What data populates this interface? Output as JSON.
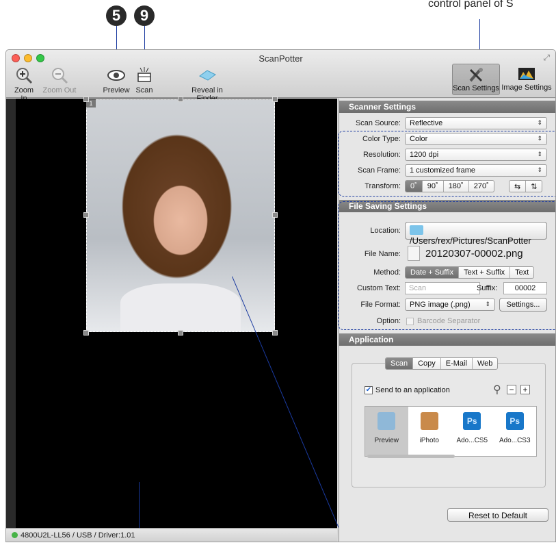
{
  "annotations": {
    "callout_5": "5",
    "callout_9": "9",
    "note_top_right": "control panel of S"
  },
  "window": {
    "title": "ScanPotter"
  },
  "toolbar": {
    "zoom_in": "Zoom In",
    "zoom_out": "Zoom Out",
    "preview": "Preview",
    "scan": "Scan",
    "reveal": "Reveal in Finder",
    "scan_settings": "Scan Settings",
    "image_settings": "Image Settings"
  },
  "preview_area": {
    "frame_number": "1"
  },
  "status": {
    "device": "4800U2L-LL56 / USB / Driver:1.01"
  },
  "scanner_settings": {
    "header": "Scanner Settings",
    "scan_source_label": "Scan Source:",
    "scan_source": "Reflective",
    "color_type_label": "Color Type:",
    "color_type": "Color",
    "resolution_label": "Resolution:",
    "resolution": "1200 dpi",
    "scan_frame_label": "Scan Frame:",
    "scan_frame": "1 customized frame",
    "transform_label": "Transform:",
    "transform_options": [
      "0˚",
      "90˚",
      "180˚",
      "270˚"
    ],
    "selected_rotation": "0˚"
  },
  "file_saving": {
    "header": "File Saving Settings",
    "location_label": "Location:",
    "location": "/Users/rex/Pictures/ScanPotter",
    "file_name_label": "File Name:",
    "file_name": "20120307-00002.png",
    "method_label": "Method:",
    "method_options": [
      "Date + Suffix",
      "Text + Suffix",
      "Text"
    ],
    "selected_method": "Date + Suffix",
    "custom_text_label": "Custom Text:",
    "custom_text_placeholder": "Scan",
    "suffix_label": "Suffix:",
    "suffix": "00002",
    "file_format_label": "File Format:",
    "file_format": "PNG image (.png)",
    "settings_button": "Settings...",
    "option_label": "Option:",
    "barcode_separator": "Barcode Separator"
  },
  "application": {
    "header": "Application",
    "tabs": [
      "Scan",
      "Copy",
      "E-Mail",
      "Web"
    ],
    "selected_tab": "Scan",
    "send_to_app_label": "Send to an application",
    "apps": [
      "Preview",
      "iPhoto",
      "Ado...CS5",
      "Ado...CS3"
    ],
    "selected_app": "Preview",
    "reset_button": "Reset to Default"
  },
  "colors": {
    "accent_line": "#1a3aa0",
    "section_header": "#7a7a7a",
    "status_dot": "#47b347"
  }
}
